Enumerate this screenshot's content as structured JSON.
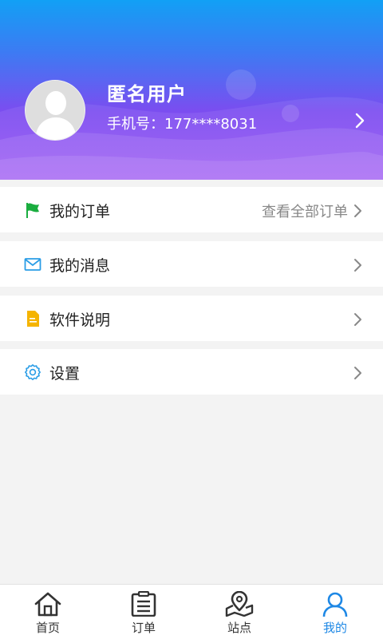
{
  "profile": {
    "name": "匿名用户",
    "phone": "手机号：177****8031"
  },
  "menu": {
    "orders": {
      "label": "我的订单",
      "extra": "查看全部订单",
      "icon": "flag-icon"
    },
    "messages": {
      "label": "我的消息",
      "icon": "mail-icon"
    },
    "about": {
      "label": "软件说明",
      "icon": "document-icon"
    },
    "settings": {
      "label": "设置",
      "icon": "gear-icon"
    }
  },
  "tabbar": {
    "home": {
      "label": "首页",
      "icon": "home-icon"
    },
    "orders": {
      "label": "订单",
      "icon": "list-icon"
    },
    "stations": {
      "label": "站点",
      "icon": "map-pin-icon"
    },
    "mine": {
      "label": "我的",
      "icon": "user-icon",
      "active": true
    }
  },
  "colors": {
    "accent": "#1e88e5",
    "header_top": "#12a0f5",
    "header_bottom": "#9b52f2",
    "flag": "#1aad3f",
    "mail": "#2a9de6",
    "document": "#f5b400",
    "gear": "#2a9de6"
  }
}
